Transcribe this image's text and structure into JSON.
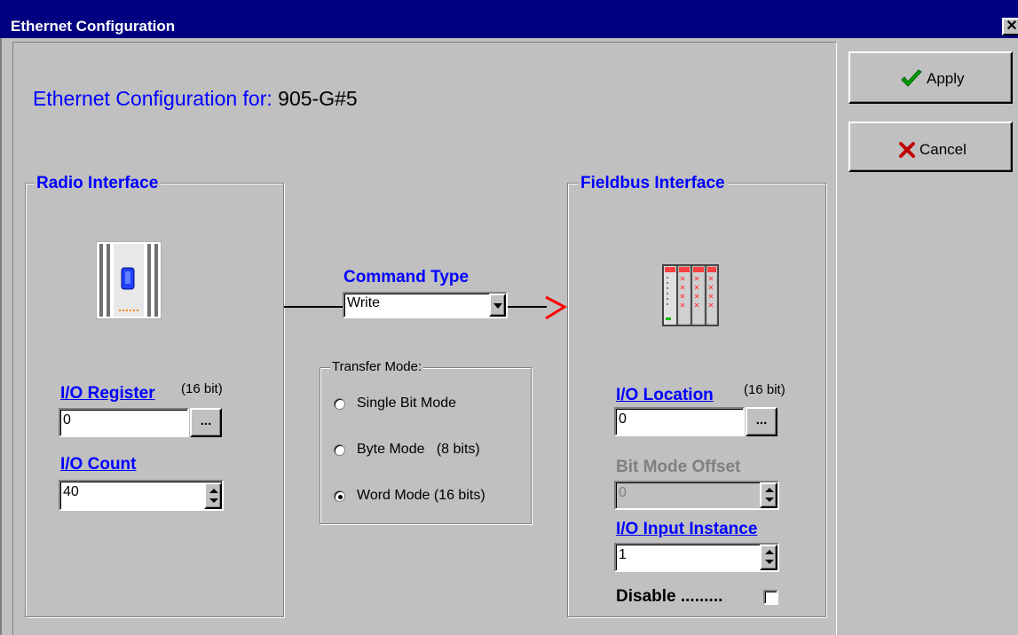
{
  "window": {
    "title": "Ethernet Configuration",
    "close_glyph": "✕"
  },
  "heading": {
    "prefix": "Ethernet Configuration for:",
    "device": "905-G#5"
  },
  "buttons": {
    "apply": "Apply",
    "cancel": "Cancel",
    "browse": "..."
  },
  "radio_interface": {
    "title": "Radio Interface",
    "io_register_label": "I/O Register",
    "io_register_note": "(16 bit)",
    "io_register_value": "0",
    "io_count_label": "I/O Count",
    "io_count_value": "40"
  },
  "command": {
    "title": "Command Type",
    "selected": "Write"
  },
  "transfer_mode": {
    "title": "Transfer Mode:",
    "options": [
      {
        "label": "Single Bit Mode",
        "selected": false
      },
      {
        "label": "Byte Mode   (8 bits)",
        "selected": false
      },
      {
        "label": "Word Mode (16 bits)",
        "selected": true
      }
    ]
  },
  "fieldbus_interface": {
    "title": "Fieldbus Interface",
    "io_location_label": "I/O Location",
    "io_location_note": "(16 bit)",
    "io_location_value": "0",
    "bit_mode_offset_label": "Bit Mode Offset",
    "bit_mode_offset_value": "0",
    "io_input_instance_label": "I/O Input Instance",
    "io_input_instance_value": "1",
    "disable_label": "Disable .........",
    "disable_checked": false
  },
  "colors": {
    "titlebar": "#000080",
    "accent_blue": "#0000ff",
    "arrow_red": "#ff0000",
    "face": "#c0c0c0"
  }
}
